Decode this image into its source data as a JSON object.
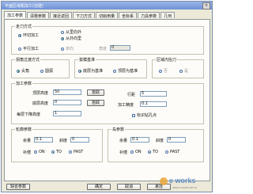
{
  "window": {
    "title": "平面区域粗加工(创建)",
    "close_glyph": "×"
  },
  "tabs": [
    "加工参数",
    "清根参数",
    "接近返回",
    "下刀方式",
    "切削用量",
    "坐标系",
    "刀具参数",
    "几何"
  ],
  "cut_mode": {
    "title": "走刀方式",
    "options": {
      "contour_parallel": "环切加工",
      "from_inside_out": "从里向外",
      "from_outside_in": "从外向里",
      "parallel": "平行加工",
      "one_way": "单向",
      "angle_label": "角度",
      "angle_value": "0"
    }
  },
  "contour_mode": {
    "title": "拐角过渡方式",
    "options": {
      "sharp": "尖角",
      "round": "圆弧"
    }
  },
  "contour_order": {
    "title": "拔模基准",
    "options": {
      "bottom": "底层为基准",
      "top": "顶层为基准"
    }
  },
  "region_corner": {
    "title": "区域内抬刀",
    "options": {
      "no": "否",
      "yes": "是"
    }
  },
  "machining": {
    "title": "加工参数",
    "top_height_label": "顶层高度",
    "top_height_value": "50",
    "bottom_height_label": "底层高度",
    "bottom_height_value": "0",
    "step_label": "每层下降高度",
    "step_value": "1",
    "pick_button": "拾取",
    "pick_button2": "拾取",
    "row_spacing_label": "行距",
    "row_spacing_value": "5",
    "allowance_label": "加工精度",
    "allowance_value": "0.1",
    "tag_check_label": "标识钻孔点"
  },
  "contour_params": {
    "title": "轮廓参数",
    "allowance_label": "余量",
    "allowance_value": "0.1",
    "slope_label": "斜度",
    "slope_value": "0",
    "offset_label": "补偿",
    "offset_on": "ON",
    "offset_to": "TO",
    "offset_past": "PAST"
  },
  "island_params": {
    "title": "岛参数",
    "allowance_label": "余量",
    "allowance_value": "0.1",
    "slope_label": "斜度",
    "slope_value": "0",
    "offset_label": "补偿",
    "offset_on": "ON",
    "offset_to": "TO",
    "offset_past": "PAST"
  },
  "footer": {
    "defaults_button": "缺省参数",
    "ok_button": "确定",
    "cancel_button": "取消",
    "hover_button": "悬挂"
  },
  "watermark": {
    "text": "e works",
    "sub": "www.e-works.net.cn"
  }
}
